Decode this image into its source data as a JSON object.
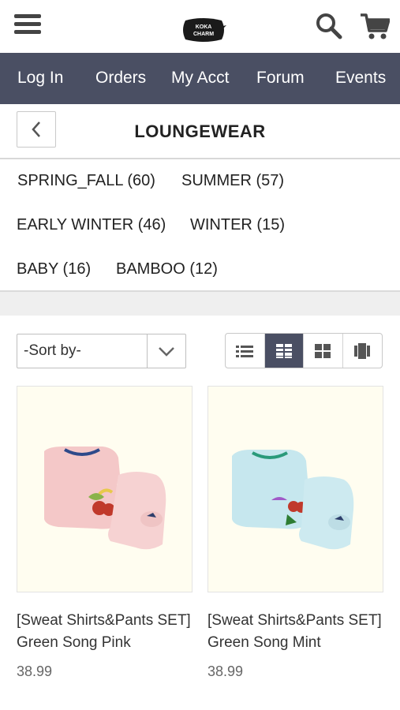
{
  "header": {
    "logo_top": "KOKA",
    "logo_bottom": "CHARM",
    "icons": [
      "hamburger-menu-icon",
      "search-icon",
      "cart-icon"
    ]
  },
  "nav": {
    "items": [
      "Log In",
      "Orders",
      "My Acct",
      "Forum",
      "Events"
    ]
  },
  "page": {
    "title": "LOUNGEWEAR"
  },
  "categories": [
    "SPRING_FALL (60)",
    "SUMMER (57)",
    "EARLY WINTER (46)",
    "WINTER (15)",
    "BABY (16)",
    "BAMBOO (12)"
  ],
  "sort": {
    "selected": "-Sort by-"
  },
  "view_modes": [
    "list-view-icon",
    "grid-view-icon",
    "large-grid-view-icon",
    "gallery-view-icon"
  ],
  "products": [
    {
      "name": "[Sweat Shirts&Pants SET] Green Song Pink",
      "price": "38.99",
      "color": "#f4c8c8"
    },
    {
      "name": "[Sweat Shirts&Pants SET] Green Song Mint",
      "price": "38.99",
      "color": "#c6e7ee"
    }
  ],
  "colors": {
    "nav_bg": "#4a4f63",
    "accent": "#4a4f63"
  }
}
